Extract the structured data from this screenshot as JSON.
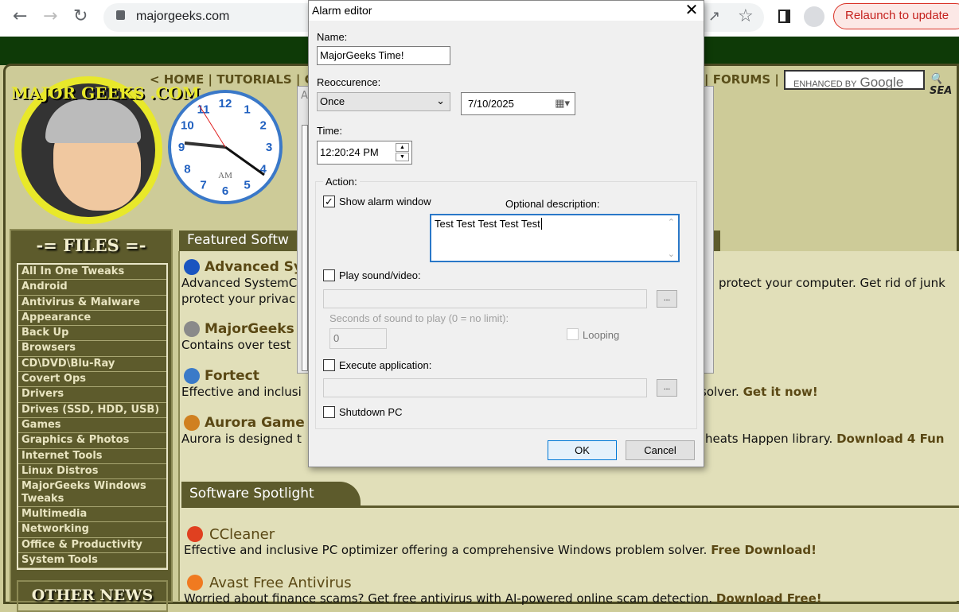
{
  "browser": {
    "url": "majorgeeks.com",
    "relaunch_label": "Relaunch to update"
  },
  "site": {
    "logo_text": "MAJOR GEEKS .COM",
    "nav_left": "< HOME | TUTORIALS | C",
    "nav_right": "| FORUMS |",
    "search_prefix": "ENHANCED BY",
    "search_brand": "Google",
    "search_label": "SEA",
    "clock": {
      "ampm": "AM",
      "numbers": [
        "12",
        "1",
        "2",
        "3",
        "4",
        "5",
        "6",
        "7",
        "8",
        "9",
        "10",
        "11"
      ]
    },
    "files_heading": "-= FILES =-",
    "categories": [
      "All In One Tweaks",
      "Android",
      "Antivirus & Malware",
      "Appearance",
      "Back Up",
      "Browsers",
      "CD\\DVD\\Blu-Ray",
      "Covert Ops",
      "Drivers",
      "Drives (SSD, HDD, USB)",
      "Games",
      "Graphics & Photos",
      "Internet Tools",
      "Linux Distros",
      "MajorGeeks Windows Tweaks",
      "Multimedia",
      "Networking",
      "Office & Productivity",
      "System Tools"
    ],
    "other_news": "OTHER NEWS",
    "featured_heading": "Featured Softw",
    "featured": [
      {
        "title": "Advanced Sys",
        "desc1": "Advanced SystemC",
        "desc1_right": "protect your computer. Get rid of junk",
        "desc2": "protect your privac"
      },
      {
        "title": "MajorGeeks",
        "desc1": "Contains over test",
        "desc1_right": "!."
      },
      {
        "title": "Fortect",
        "desc1": "Effective and inclusi",
        "desc1_right": "solver.",
        "link": "Get it now!"
      },
      {
        "title": "Aurora Game",
        "desc1": "Aurora is designed t",
        "desc1_right": "heats Happen library.",
        "link": "Download 4 Fun"
      }
    ],
    "spotlight_heading": "Software Spotlight",
    "spotlight": [
      {
        "title": "CCleaner",
        "desc": "Effective and inclusive PC optimizer offering a comprehensive Windows problem solver.",
        "link": "Free Download!"
      },
      {
        "title": "Avast Free Antivirus",
        "desc": "Worried about finance scams? Get free antivirus with AI-powered online scam detection.",
        "link": "Download Free!"
      }
    ]
  },
  "background_window": {
    "title": "A"
  },
  "dialog": {
    "title": "Alarm editor",
    "name_label": "Name:",
    "name_value": "MajorGeeks Time!",
    "recurrence_label": "Reoccurence:",
    "recurrence_value": "Once",
    "date_value": "7/10/2025",
    "time_label": "Time:",
    "time_value": "12:20:24 PM",
    "action_label": "Action:",
    "show_alarm_label": "Show alarm window",
    "show_alarm_checked": true,
    "desc_label": "Optional description:",
    "desc_value": "Test Test Test Test Test",
    "play_sound_label": "Play sound/video:",
    "play_sound_checked": false,
    "browse_label": "...",
    "seconds_label": "Seconds of sound to play (0 = no limit):",
    "seconds_value": "0",
    "looping_label": "Looping",
    "execute_label": "Execute application:",
    "execute_checked": false,
    "shutdown_label": "Shutdown PC",
    "shutdown_checked": false,
    "ok_label": "OK",
    "cancel_label": "Cancel"
  }
}
